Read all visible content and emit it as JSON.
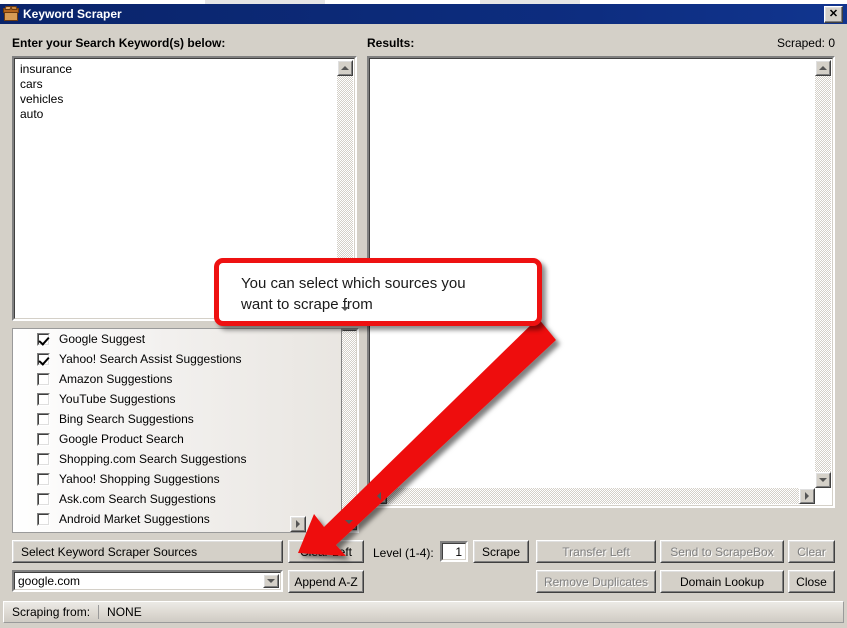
{
  "window": {
    "title": "Keyword Scraper",
    "icon": "box-icon",
    "close_label": "✕"
  },
  "labels": {
    "keywords_heading": "Enter your Search Keyword(s) below:",
    "results_heading": "Results:",
    "scraped_counter": "Scraped: 0",
    "level_label": "Level (1-4):"
  },
  "keywords": {
    "value": "insurance\ncars\nvehicles\nauto"
  },
  "results": {
    "value": ""
  },
  "sources": {
    "items": [
      {
        "label": "Google Suggest",
        "checked": true
      },
      {
        "label": "Yahoo! Search Assist Suggestions",
        "checked": true
      },
      {
        "label": "Amazon Suggestions",
        "checked": false
      },
      {
        "label": "YouTube Suggestions",
        "checked": false
      },
      {
        "label": "Bing Search Suggestions",
        "checked": false
      },
      {
        "label": "Google Product Search",
        "checked": false
      },
      {
        "label": "Shopping.com Search Suggestions",
        "checked": false
      },
      {
        "label": "Yahoo! Shopping Suggestions",
        "checked": false
      },
      {
        "label": "Ask.com Search Suggestions",
        "checked": false
      },
      {
        "label": "Android Market Suggestions",
        "checked": false
      }
    ]
  },
  "buttons": {
    "select_sources": "Select Keyword Scraper Sources",
    "clear_left": "Clear Left",
    "scrape": "Scrape",
    "transfer_left": "Transfer Left",
    "send_to_scrapebox": "Send to ScrapeBox",
    "clear": "Clear",
    "append_az": "Append A-Z",
    "remove_duplicates": "Remove Duplicates",
    "domain_lookup": "Domain Lookup",
    "close": "Close"
  },
  "level": {
    "value": "1"
  },
  "engine_combo": {
    "value": "google.com"
  },
  "statusbar": {
    "label": "Scraping from:",
    "value": "NONE"
  },
  "annotation": {
    "text": "You can select which sources you\nwant to scrape from",
    "color": "#ee1111"
  },
  "theme": {
    "titlebar": "#0a246a",
    "dialog_face": "#d4d0c8",
    "field_bg": "#ffffff",
    "disabled_text": "#808080"
  }
}
